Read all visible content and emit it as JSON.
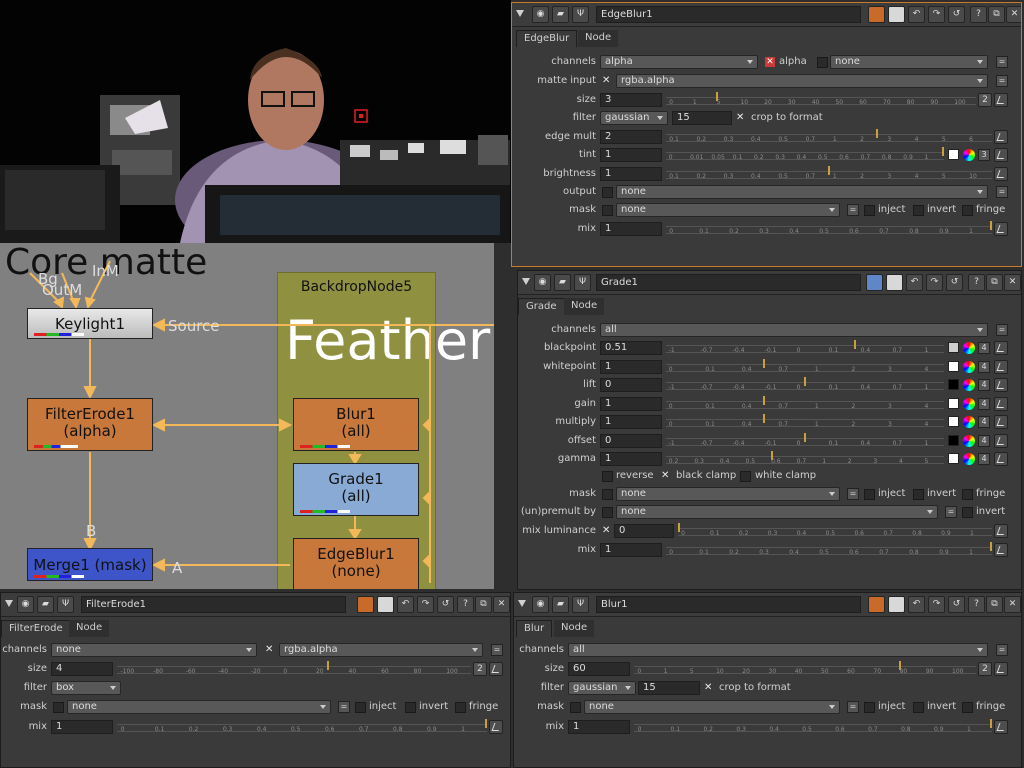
{
  "viewer": {
    "description_alt": "camera viewer"
  },
  "graph": {
    "title": "Core matte",
    "input_labels": [
      "Bg",
      "OutM",
      "InM"
    ],
    "source_label": "Source",
    "backdrop": {
      "label": "BackdropNode5",
      "big_text": "Feather"
    },
    "nodes": {
      "keylight": "Keylight1",
      "filtererode_line1": "FilterErode1",
      "filtererode_line2": "(alpha)",
      "blur_line1": "Blur1",
      "blur_line2": "(all)",
      "grade_line1": "Grade1",
      "grade_line2": "(all)",
      "edgeblur_line1": "EdgeBlur1",
      "edgeblur_line2": "(none)",
      "merge": "Merge1 (mask)"
    },
    "pipe_labels": {
      "b": "B",
      "a": "A"
    }
  },
  "edgeblur": {
    "name": "EdgeBlur1",
    "tabs": [
      "EdgeBlur",
      "Node"
    ],
    "channels_label": "channels",
    "channels_value": "alpha",
    "alpha_label": "alpha",
    "none_value": "none",
    "matte_label": "matte input",
    "matte_value": "rgba.alpha",
    "size_label": "size",
    "size_value": "3",
    "size_ticks": [
      "0",
      "1",
      "5",
      "10",
      "20",
      "30",
      "40",
      "50",
      "60",
      "70",
      "80",
      "90",
      "100"
    ],
    "size_btn": "2",
    "filter_label": "filter",
    "filter_value": "gaussian",
    "filter_num": "15",
    "crop_label": "crop to format",
    "edgemult_label": "edge mult",
    "edgemult_value": "2",
    "edgemult_ticks": [
      "0.1",
      "0.2",
      "0.3",
      "0.4",
      "0.5",
      "0.7",
      "1",
      "2",
      "3",
      "4",
      "5",
      "6"
    ],
    "tint_label": "tint",
    "tint_value": "1",
    "tint_ticks": [
      "0",
      "0.01",
      "0.05",
      "0.1",
      "0.2",
      "0.3",
      "0.4",
      "0.5",
      "0.6",
      "0.7",
      "0.8",
      "0.9",
      "1"
    ],
    "tint_btn": "3",
    "brightness_label": "brightness",
    "brightness_value": "1",
    "brightness_ticks": [
      "0.1",
      "0.2",
      "0.3",
      "0.4",
      "0.5",
      "0.7",
      "1",
      "2",
      "3",
      "4",
      "5",
      "10"
    ],
    "output_label": "output",
    "output_value": "none",
    "mask_label": "mask",
    "mask_value": "none",
    "inject_label": "inject",
    "invert_label": "invert",
    "fringe_label": "fringe",
    "mix_label": "mix",
    "mix_value": "1",
    "mix_ticks": [
      "0",
      "0.1",
      "0.2",
      "0.3",
      "0.4",
      "0.5",
      "0.6",
      "0.7",
      "0.8",
      "0.9",
      "1"
    ]
  },
  "grade": {
    "name": "Grade1",
    "tabs": [
      "Grade",
      "Node"
    ],
    "channels_label": "channels",
    "channels_value": "all",
    "rows": [
      {
        "label": "blackpoint",
        "value": "0.51",
        "ticks": [
          "-1",
          "-0.7",
          "-0.4",
          "-0.1",
          "0",
          "0.1",
          "0.4",
          "0.7",
          "1"
        ]
      },
      {
        "label": "whitepoint",
        "value": "1",
        "ticks": [
          "0",
          "0.1",
          "0.4",
          "0.7",
          "1",
          "2",
          "3",
          "4"
        ]
      },
      {
        "label": "lift",
        "value": "0",
        "ticks": [
          "-1",
          "-0.7",
          "-0.4",
          "-0.1",
          "0",
          "0.1",
          "0.4",
          "0.7",
          "1"
        ]
      },
      {
        "label": "gain",
        "value": "1",
        "ticks": [
          "0",
          "0.1",
          "0.4",
          "0.7",
          "1",
          "2",
          "3",
          "4"
        ]
      },
      {
        "label": "multiply",
        "value": "1",
        "ticks": [
          "0",
          "0.1",
          "0.4",
          "0.7",
          "1",
          "2",
          "3",
          "4"
        ]
      },
      {
        "label": "offset",
        "value": "0",
        "ticks": [
          "-1",
          "-0.7",
          "-0.4",
          "-0.1",
          "0",
          "0.1",
          "0.4",
          "0.7",
          "1"
        ]
      },
      {
        "label": "gamma",
        "value": "1",
        "ticks": [
          "0.2",
          "0.3",
          "0.4",
          "0.5",
          "0.6",
          "0.7",
          "1",
          "2",
          "3",
          "4",
          "5"
        ]
      }
    ],
    "row_btn": "4",
    "reverse_label": "reverse",
    "blackclamp_label": "black clamp",
    "whiteclamp_label": "white clamp",
    "mask_label": "mask",
    "mask_value": "none",
    "inject_label": "inject",
    "invert_label": "invert",
    "fringe_label": "fringe",
    "unpremult_label": "(un)premult by",
    "unpremult_value": "none",
    "invert2_label": "invert",
    "mixlum_label": "mix luminance",
    "mixlum_value": "0",
    "mixlum_ticks": [
      "0",
      "0.1",
      "0.2",
      "0.3",
      "0.4",
      "0.5",
      "0.6",
      "0.7",
      "0.8",
      "0.9",
      "1"
    ],
    "mix_label": "mix",
    "mix_value": "1",
    "mix_ticks": [
      "0",
      "0.1",
      "0.2",
      "0.3",
      "0.4",
      "0.5",
      "0.6",
      "0.7",
      "0.8",
      "0.9",
      "1"
    ]
  },
  "filtererode": {
    "name": "FilterErode1",
    "tabs": [
      "FilterErode",
      "Node"
    ],
    "channels_label": "channels",
    "channels_value": "none",
    "channels_right": "rgba.alpha",
    "size_label": "size",
    "size_value": "4",
    "size_ticks": [
      "-100",
      "-80",
      "-60",
      "-40",
      "-20",
      "0",
      "20",
      "40",
      "60",
      "80",
      "100"
    ],
    "size_btn": "2",
    "filter_label": "filter",
    "filter_value": "box",
    "mask_label": "mask",
    "mask_value": "none",
    "inject_label": "inject",
    "invert_label": "invert",
    "fringe_label": "fringe",
    "mix_label": "mix",
    "mix_value": "1",
    "mix_ticks": [
      "0",
      "0.1",
      "0.2",
      "0.3",
      "0.4",
      "0.5",
      "0.6",
      "0.7",
      "0.8",
      "0.9",
      "1"
    ]
  },
  "blur": {
    "name": "Blur1",
    "tabs": [
      "Blur",
      "Node"
    ],
    "channels_label": "channels",
    "channels_value": "all",
    "size_label": "size",
    "size_value": "60",
    "size_ticks": [
      "0",
      "1",
      "5",
      "10",
      "20",
      "30",
      "40",
      "50",
      "60",
      "70",
      "80",
      "90",
      "100"
    ],
    "size_btn": "2",
    "filter_label": "filter",
    "filter_value": "gaussian",
    "filter_num": "15",
    "crop_label": "crop to format",
    "mask_label": "mask",
    "mask_value": "none",
    "inject_label": "inject",
    "invert_label": "invert",
    "fringe_label": "fringe",
    "mix_label": "mix",
    "mix_value": "1",
    "mix_ticks": [
      "0",
      "0.1",
      "0.2",
      "0.3",
      "0.4",
      "0.5",
      "0.6",
      "0.7",
      "0.8",
      "0.9",
      "1"
    ]
  },
  "colors": {
    "orange_node": "#c8783a",
    "blue_node": "#8aaad6",
    "merge_node": "#3d55c8",
    "pipe": "#f2b85a",
    "backdrop": "#8f9140",
    "graph_bg": "#7f7f7f"
  }
}
